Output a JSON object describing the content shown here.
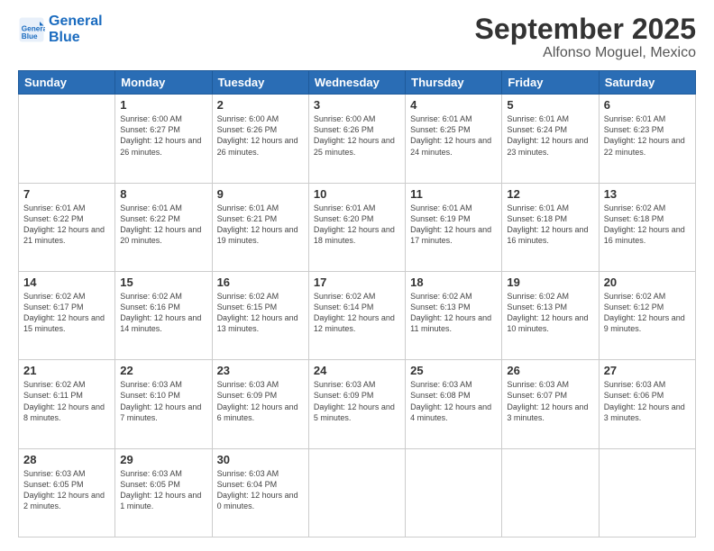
{
  "logo": {
    "line1": "General",
    "line2": "Blue"
  },
  "title": "September 2025",
  "subtitle": "Alfonso Moguel, Mexico",
  "weekdays": [
    "Sunday",
    "Monday",
    "Tuesday",
    "Wednesday",
    "Thursday",
    "Friday",
    "Saturday"
  ],
  "weeks": [
    [
      {
        "day": "",
        "sunrise": "",
        "sunset": "",
        "daylight": ""
      },
      {
        "day": "1",
        "sunrise": "6:00 AM",
        "sunset": "6:27 PM",
        "daylight": "12 hours and 26 minutes."
      },
      {
        "day": "2",
        "sunrise": "6:00 AM",
        "sunset": "6:26 PM",
        "daylight": "12 hours and 26 minutes."
      },
      {
        "day": "3",
        "sunrise": "6:00 AM",
        "sunset": "6:26 PM",
        "daylight": "12 hours and 25 minutes."
      },
      {
        "day": "4",
        "sunrise": "6:01 AM",
        "sunset": "6:25 PM",
        "daylight": "12 hours and 24 minutes."
      },
      {
        "day": "5",
        "sunrise": "6:01 AM",
        "sunset": "6:24 PM",
        "daylight": "12 hours and 23 minutes."
      },
      {
        "day": "6",
        "sunrise": "6:01 AM",
        "sunset": "6:23 PM",
        "daylight": "12 hours and 22 minutes."
      }
    ],
    [
      {
        "day": "7",
        "sunrise": "6:01 AM",
        "sunset": "6:22 PM",
        "daylight": "12 hours and 21 minutes."
      },
      {
        "day": "8",
        "sunrise": "6:01 AM",
        "sunset": "6:22 PM",
        "daylight": "12 hours and 20 minutes."
      },
      {
        "day": "9",
        "sunrise": "6:01 AM",
        "sunset": "6:21 PM",
        "daylight": "12 hours and 19 minutes."
      },
      {
        "day": "10",
        "sunrise": "6:01 AM",
        "sunset": "6:20 PM",
        "daylight": "12 hours and 18 minutes."
      },
      {
        "day": "11",
        "sunrise": "6:01 AM",
        "sunset": "6:19 PM",
        "daylight": "12 hours and 17 minutes."
      },
      {
        "day": "12",
        "sunrise": "6:01 AM",
        "sunset": "6:18 PM",
        "daylight": "12 hours and 16 minutes."
      },
      {
        "day": "13",
        "sunrise": "6:02 AM",
        "sunset": "6:18 PM",
        "daylight": "12 hours and 16 minutes."
      }
    ],
    [
      {
        "day": "14",
        "sunrise": "6:02 AM",
        "sunset": "6:17 PM",
        "daylight": "12 hours and 15 minutes."
      },
      {
        "day": "15",
        "sunrise": "6:02 AM",
        "sunset": "6:16 PM",
        "daylight": "12 hours and 14 minutes."
      },
      {
        "day": "16",
        "sunrise": "6:02 AM",
        "sunset": "6:15 PM",
        "daylight": "12 hours and 13 minutes."
      },
      {
        "day": "17",
        "sunrise": "6:02 AM",
        "sunset": "6:14 PM",
        "daylight": "12 hours and 12 minutes."
      },
      {
        "day": "18",
        "sunrise": "6:02 AM",
        "sunset": "6:13 PM",
        "daylight": "12 hours and 11 minutes."
      },
      {
        "day": "19",
        "sunrise": "6:02 AM",
        "sunset": "6:13 PM",
        "daylight": "12 hours and 10 minutes."
      },
      {
        "day": "20",
        "sunrise": "6:02 AM",
        "sunset": "6:12 PM",
        "daylight": "12 hours and 9 minutes."
      }
    ],
    [
      {
        "day": "21",
        "sunrise": "6:02 AM",
        "sunset": "6:11 PM",
        "daylight": "12 hours and 8 minutes."
      },
      {
        "day": "22",
        "sunrise": "6:03 AM",
        "sunset": "6:10 PM",
        "daylight": "12 hours and 7 minutes."
      },
      {
        "day": "23",
        "sunrise": "6:03 AM",
        "sunset": "6:09 PM",
        "daylight": "12 hours and 6 minutes."
      },
      {
        "day": "24",
        "sunrise": "6:03 AM",
        "sunset": "6:09 PM",
        "daylight": "12 hours and 5 minutes."
      },
      {
        "day": "25",
        "sunrise": "6:03 AM",
        "sunset": "6:08 PM",
        "daylight": "12 hours and 4 minutes."
      },
      {
        "day": "26",
        "sunrise": "6:03 AM",
        "sunset": "6:07 PM",
        "daylight": "12 hours and 3 minutes."
      },
      {
        "day": "27",
        "sunrise": "6:03 AM",
        "sunset": "6:06 PM",
        "daylight": "12 hours and 3 minutes."
      }
    ],
    [
      {
        "day": "28",
        "sunrise": "6:03 AM",
        "sunset": "6:05 PM",
        "daylight": "12 hours and 2 minutes."
      },
      {
        "day": "29",
        "sunrise": "6:03 AM",
        "sunset": "6:05 PM",
        "daylight": "12 hours and 1 minute."
      },
      {
        "day": "30",
        "sunrise": "6:03 AM",
        "sunset": "6:04 PM",
        "daylight": "12 hours and 0 minutes."
      },
      {
        "day": "",
        "sunrise": "",
        "sunset": "",
        "daylight": ""
      },
      {
        "day": "",
        "sunrise": "",
        "sunset": "",
        "daylight": ""
      },
      {
        "day": "",
        "sunrise": "",
        "sunset": "",
        "daylight": ""
      },
      {
        "day": "",
        "sunrise": "",
        "sunset": "",
        "daylight": ""
      }
    ]
  ],
  "labels": {
    "sunrise": "Sunrise:",
    "sunset": "Sunset:",
    "daylight": "Daylight:"
  }
}
